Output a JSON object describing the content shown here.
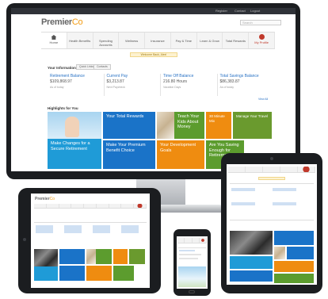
{
  "desktop": {
    "utility_links": [
      "Register",
      "Contact",
      "Logout"
    ],
    "brand": {
      "name": "Premier",
      "suffix": "Co"
    },
    "search_placeholder": "Search",
    "nav": [
      {
        "label": "Home",
        "icon": "home-icon"
      },
      {
        "label": "Health Benefits"
      },
      {
        "label": "Spending Accounts"
      },
      {
        "label": "Wellness"
      },
      {
        "label": "Insurance"
      },
      {
        "label": "Pay & Time"
      },
      {
        "label": "Learn & Grow"
      },
      {
        "label": "Total Rewards"
      },
      {
        "label": "My Profile",
        "icon": "alert-dot-icon"
      }
    ],
    "alert": "Welcome Back, Alex!",
    "info_title": "Your Information",
    "info_tabs": [
      "Quick Links",
      "Contacts"
    ],
    "metrics": [
      {
        "label": "Retirement Balance",
        "value": "$109,868.97",
        "sub": "As of today"
      },
      {
        "label": "Current Pay",
        "value": "$3,213.87",
        "sub": "Next Paycheck"
      },
      {
        "label": "Time Off Balance",
        "value": "216.80 Hours",
        "sub": "Vacation Days"
      },
      {
        "label": "Total Savings Balance",
        "value": "$86,383.87",
        "sub": "As of today"
      }
    ],
    "view_all": "View All",
    "highlights_title": "Highlights for You",
    "tiles": [
      {
        "text": "Make Changes for a Secure Retirement",
        "color": "#1f9bd7"
      },
      {
        "text": "Your Total Rewards",
        "color": "#1a73c8"
      },
      {
        "text": "Make Your Premium Benefit Choice",
        "color": "#1a73c8"
      },
      {
        "text": "Teach Your Kids About Money",
        "color": "#5c9c2e"
      },
      {
        "text": "Your Development Goals",
        "color": "#ef8c10"
      },
      {
        "text": "30 Minute Mix",
        "color": "#ef8c10"
      },
      {
        "text": "Manage Your Travel",
        "color": "#6a9a2e"
      },
      {
        "text": "Are You Saving Enough for Retirement?",
        "color": "#5c9c2e"
      }
    ]
  },
  "mini": {
    "brand": "Premier",
    "brand_suffix": "Co"
  },
  "colors": {
    "accent_blue": "#1a73c8",
    "accent_green": "#5c9c2e",
    "accent_orange": "#ef8c10",
    "brand_orange": "#f39c12",
    "alert_red": "#c0392b"
  }
}
